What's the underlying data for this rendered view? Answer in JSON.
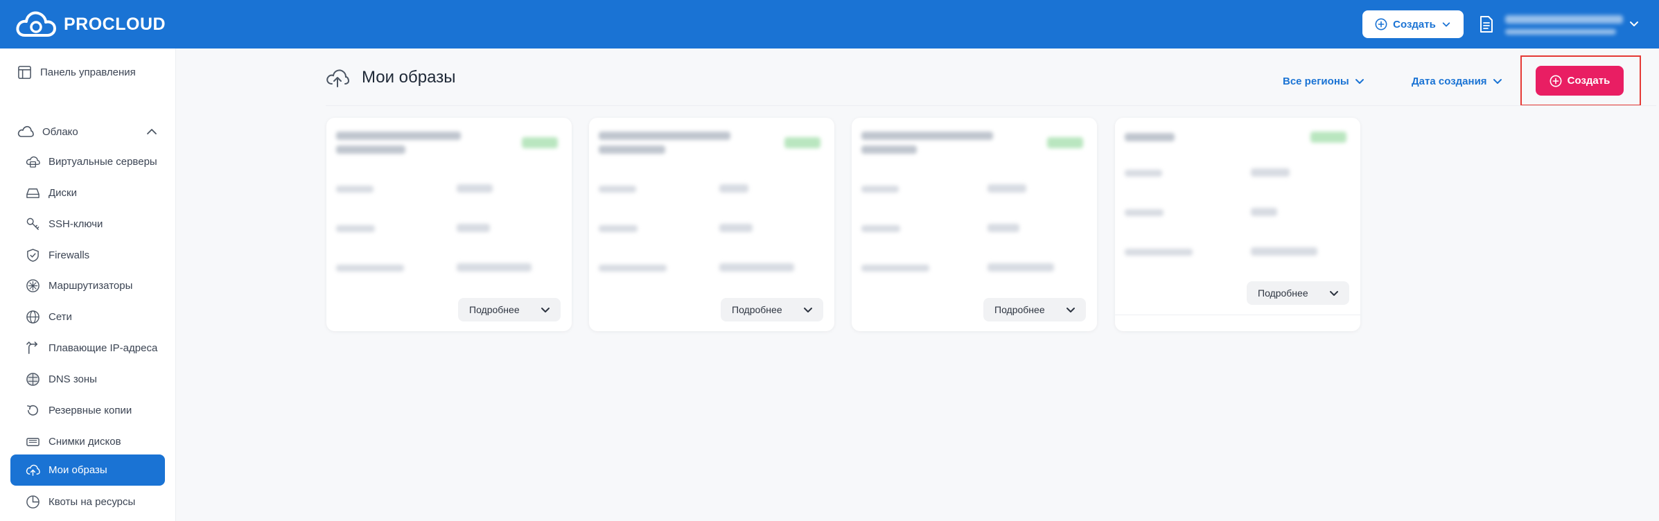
{
  "header": {
    "brand": "PROCLOUD",
    "create_label": "Создать"
  },
  "sidebar": {
    "dashboard": "Панель управления",
    "group": "Облако",
    "items": [
      {
        "label": "Виртуальные серверы",
        "icon": "server-icon"
      },
      {
        "label": "Диски",
        "icon": "disk-icon"
      },
      {
        "label": "SSH-ключи",
        "icon": "key-icon"
      },
      {
        "label": "Firewalls",
        "icon": "shield-icon"
      },
      {
        "label": "Маршрутизаторы",
        "icon": "router-icon"
      },
      {
        "label": "Сети",
        "icon": "globe-icon"
      },
      {
        "label": "Плавающие IP-адреса",
        "icon": "floating-ip-icon"
      },
      {
        "label": "DNS зоны",
        "icon": "dns-icon"
      },
      {
        "label": "Резервные копии",
        "icon": "backup-icon"
      },
      {
        "label": "Снимки дисков",
        "icon": "snapshot-icon"
      },
      {
        "label": "Мои образы",
        "icon": "cloud-upload-icon",
        "active": true
      },
      {
        "label": "Квоты на ресурсы",
        "icon": "pie-icon"
      }
    ]
  },
  "main": {
    "title": "Мои образы",
    "filter_regions": "Все регионы",
    "filter_date": "Дата создания",
    "create_label": "Создать",
    "cards": [
      {
        "details_label": "Подробнее"
      },
      {
        "details_label": "Подробнее"
      },
      {
        "details_label": "Подробнее"
      },
      {
        "details_label": "Подробнее"
      }
    ]
  },
  "colors": {
    "brand_blue": "#1a73d4",
    "create_pink": "#e91e63",
    "highlight_red": "#e53935"
  }
}
